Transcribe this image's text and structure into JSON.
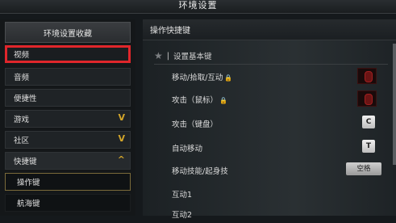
{
  "window": {
    "title": "环境设置"
  },
  "sidebar": {
    "header": "环境设置收藏",
    "items": [
      {
        "label": "视频",
        "selected": true
      },
      {
        "label": "音频"
      },
      {
        "label": "便捷性"
      },
      {
        "label": "游戏",
        "chevron": "V"
      },
      {
        "label": "社区",
        "chevron": "V"
      },
      {
        "label": "快捷键",
        "chevron": "^"
      },
      {
        "label": "操作键"
      },
      {
        "label": "航海键"
      }
    ]
  },
  "panel": {
    "header": "操作快捷键",
    "section_title": "设置基本键",
    "rows": [
      {
        "label": "移动/拾取/互动",
        "lock": "🔒",
        "key": "mouse-right"
      },
      {
        "label": "攻击（鼠标）",
        "lock": "🔒",
        "key": "mouse-left"
      },
      {
        "label": "攻击（键盘）",
        "key": "C"
      },
      {
        "label": "自动移动",
        "key": "T"
      },
      {
        "label": "移动技能/起身技",
        "key": "空格"
      },
      {
        "label": "互动1"
      },
      {
        "label": "互动2"
      }
    ]
  },
  "colors": {
    "selected_border": "#e0262b",
    "chevron": "#d4a62a"
  }
}
